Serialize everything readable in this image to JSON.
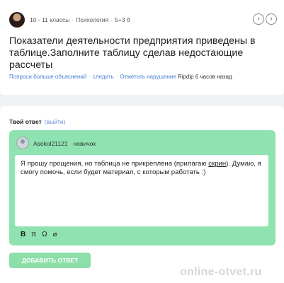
{
  "question": {
    "grade": "10 - 11 классы",
    "subject": "Психология",
    "points": "5+3 б",
    "title": "Показатели деятельности предприятия приведены в таблице.Заполните таблицу сделав недостающие рассчеты",
    "ask_more": "Попроси больше объяснений",
    "follow": "следить",
    "report": "Отметить нарушение",
    "author": "Ripdip",
    "time": "6 часов назад",
    "nav_prev": "‹",
    "nav_next": "›"
  },
  "answer": {
    "heading": "Твой ответ",
    "exit_link": "(выйти)",
    "user": "Asokol21121",
    "rank": "новичок",
    "text_before": "Я прошу прощения, но таблица не прикреплена (прилагаю ",
    "text_link": "скрин",
    "text_after": "). Думаю, я смогу помочь, если будет материал, с которым работать :)",
    "tools": {
      "bold": "B",
      "pi": "π",
      "omega": "Ω",
      "attach": "⌀"
    },
    "submit": "ДОБАВИТЬ ОТВЕТ"
  },
  "watermark": "online-otvet.ru"
}
